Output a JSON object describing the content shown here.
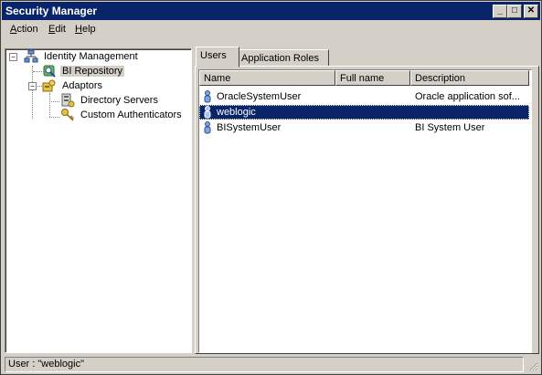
{
  "window": {
    "title": "Security Manager",
    "minimize": "_",
    "maximize": "□",
    "close": "✕"
  },
  "menu": [
    {
      "label": "Action",
      "accel": "A",
      "rest": "ction"
    },
    {
      "label": "Edit",
      "accel": "E",
      "rest": "dit"
    },
    {
      "label": "Help",
      "accel": "H",
      "rest": "elp"
    }
  ],
  "tree": {
    "root": "Identity Management",
    "bi_repository": "BI Repository",
    "adaptors": "Adaptors",
    "directory_servers": "Directory Servers",
    "custom_authenticators": "Custom Authenticators"
  },
  "tabs": {
    "users": "Users",
    "application_roles": "Application Roles"
  },
  "columns": {
    "name": "Name",
    "full_name": "Full name",
    "description": "Description"
  },
  "users": [
    {
      "name": "OracleSystemUser",
      "full_name": "",
      "description": "Oracle application sof..."
    },
    {
      "name": "weblogic",
      "full_name": "",
      "description": ""
    },
    {
      "name": "BISystemUser",
      "full_name": "",
      "description": "BI System User"
    }
  ],
  "status": {
    "text": "User : \"weblogic\""
  },
  "colors": {
    "titlebar": "#0a246a",
    "selection": "#0a246a",
    "chrome": "#d4d0c8"
  }
}
